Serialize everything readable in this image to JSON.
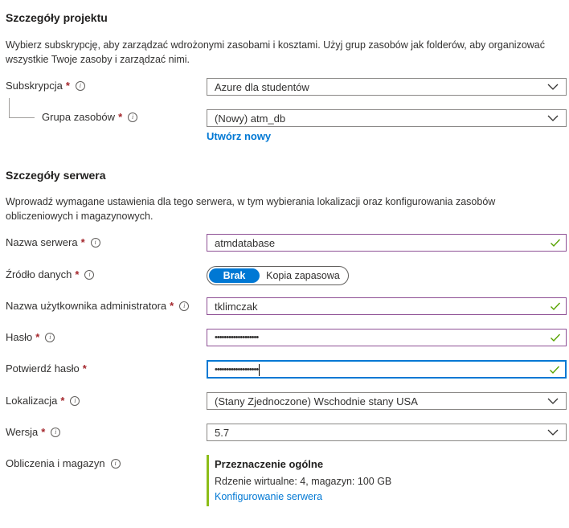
{
  "project": {
    "title": "Szczegóły projektu",
    "description": "Wybierz subskrypcję, aby zarządzać wdrożonymi zasobami i kosztami. Użyj grup zasobów jak folderów, aby organizować wszystkie Twoje zasoby i zarządzać nimi.",
    "subscription_label": "Subskrypcja",
    "subscription_value": "Azure dla studentów",
    "resource_group_label": "Grupa zasobów",
    "resource_group_value": "(Nowy) atm_db",
    "create_new_link": "Utwórz nowy"
  },
  "server": {
    "title": "Szczegóły serwera",
    "description": "Wprowadź wymagane ustawienia dla tego serwera, w tym wybierania lokalizacji oraz konfigurowania zasobów obliczeniowych i magazynowych.",
    "name_label": "Nazwa serwera",
    "name_value": "atmdatabase",
    "source_label": "Źródło danych",
    "source_options": [
      "Brak",
      "Kopia zapasowa"
    ],
    "source_selected": "Brak",
    "admin_label": "Nazwa użytkownika administratora",
    "admin_value": "tklimczak",
    "password_label": "Hasło",
    "password_mask": "•••••••••••••••••••",
    "confirm_label": "Potwierdź hasło",
    "confirm_mask": "•••••••••••••••••••",
    "location_label": "Lokalizacja",
    "location_value": "(Stany Zjednoczone) Wschodnie stany USA",
    "version_label": "Wersja",
    "version_value": "5.7",
    "compute_label": "Obliczenia i magazyn",
    "compute_tier": "Przeznaczenie ogólne",
    "compute_details": "Rdzenie wirtualne: 4, magazyn: 100 GB",
    "configure_link": "Konfigurowanie serwera"
  },
  "symbols": {
    "required": "*",
    "info": "i"
  },
  "colors": {
    "accent": "#0078d4",
    "valid_border": "#8e5095",
    "check": "#57a300",
    "tier_bar": "#8cbd18",
    "required": "#a4262c"
  }
}
